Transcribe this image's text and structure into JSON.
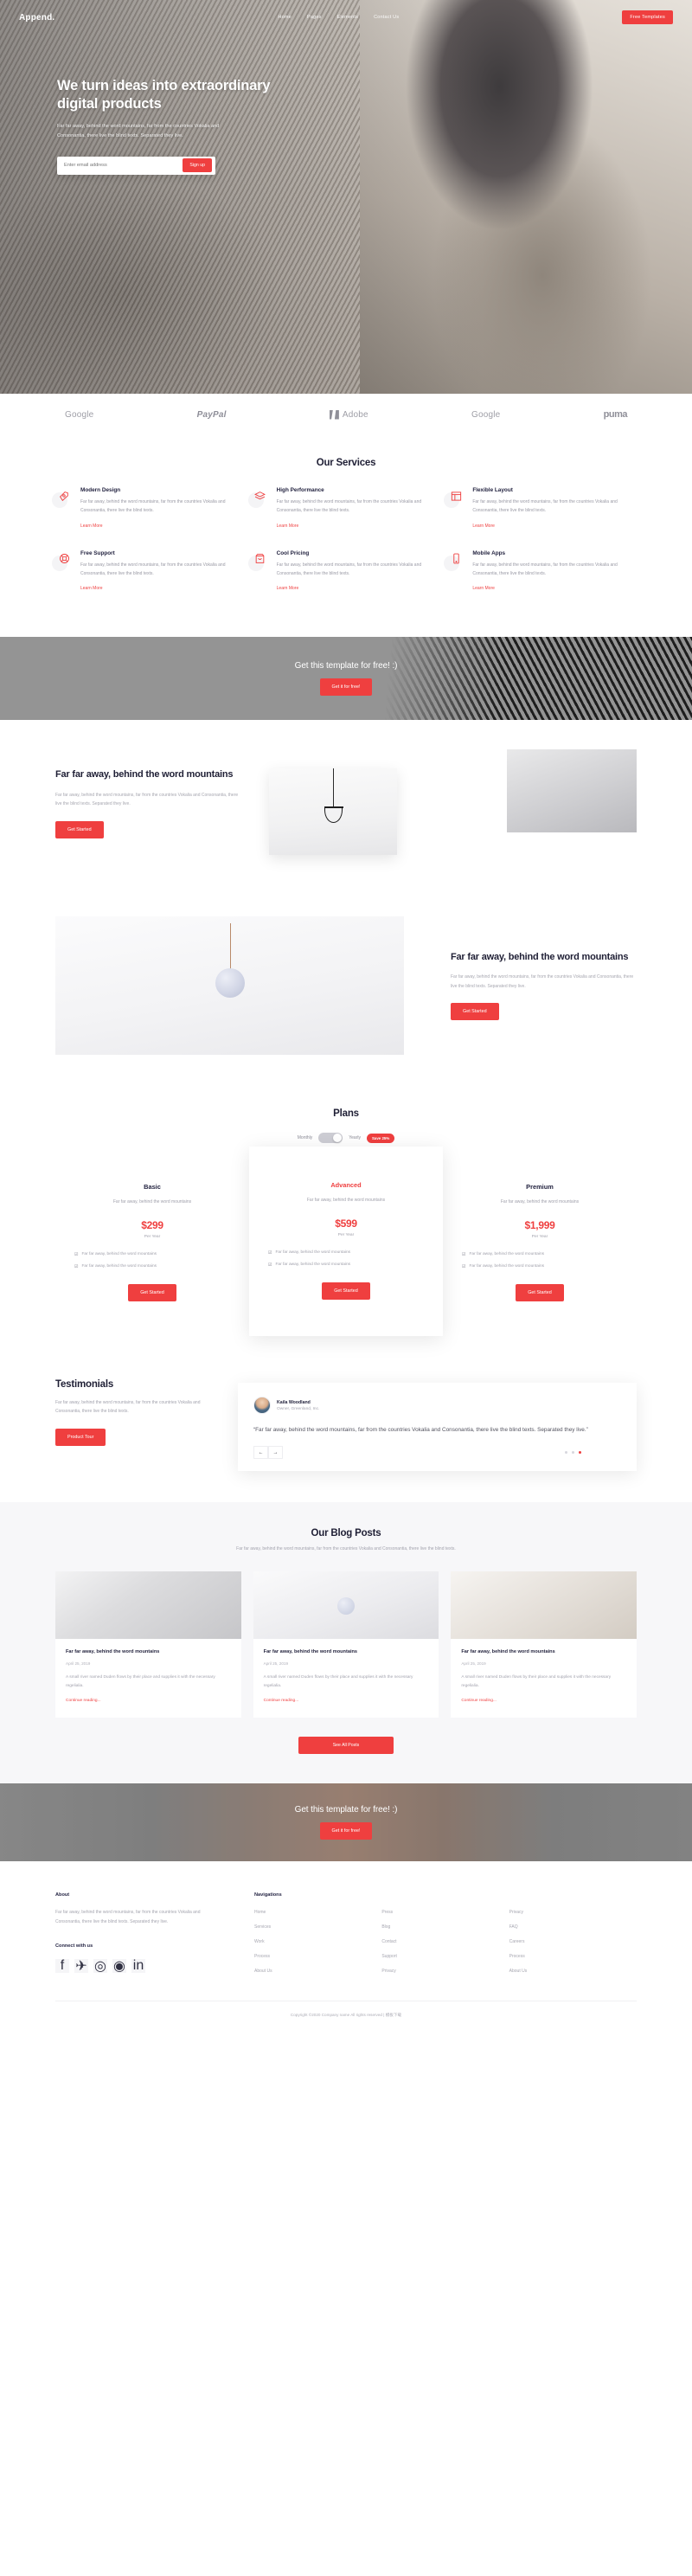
{
  "header": {
    "brand": "Append.",
    "nav": [
      {
        "label": "Home"
      },
      {
        "label": "Pages"
      },
      {
        "label": "Elements"
      },
      {
        "label": "Contact Us"
      }
    ],
    "cta_label": "Free Templates"
  },
  "hero": {
    "title": "We turn ideas into extraordinary digital products",
    "subtitle": "Far far away, behind the word mountains, far from the countries Vokalia and Consonantia, there live the blind texts. Separated they live.",
    "email_placeholder": "Enter email address",
    "email_value": "",
    "signup_label": "Sign up"
  },
  "brands": [
    {
      "name": "Google"
    },
    {
      "name": "PayPal"
    },
    {
      "name": "Adobe"
    },
    {
      "name": "Google"
    },
    {
      "name": "puma"
    }
  ],
  "services": {
    "title": "Our Services",
    "link_label": "Learn More",
    "items": [
      {
        "icon": "pen-nib-icon",
        "title": "Modern Design",
        "text": "Far far away, behind the word mountains, far from the countries Vokalia and Consonantia, there live the blind texts."
      },
      {
        "icon": "layers-icon",
        "title": "High Performance",
        "text": "Far far away, behind the word mountains, far from the countries Vokalia and Consonantia, there live the blind texts."
      },
      {
        "icon": "window-layout-icon",
        "title": "Flexible Layout",
        "text": "Far far away, behind the word mountains, far from the countries Vokalia and Consonantia, there live the blind texts."
      },
      {
        "icon": "lifebuoy-icon",
        "title": "Free Support",
        "text": "Far far away, behind the word mountains, far from the countries Vokalia and Consonantia, there live the blind texts."
      },
      {
        "icon": "shopping-bag-icon",
        "title": "Cool Pricing",
        "text": "Far far away, behind the word mountains, far from the countries Vokalia and Consonantia, there live the blind texts."
      },
      {
        "icon": "mobile-phone-icon",
        "title": "Mobile Apps",
        "text": "Far far away, behind the word mountains, far from the countries Vokalia and Consonantia, there live the blind texts."
      }
    ]
  },
  "cta_banner": {
    "heading": "Get this template for free! :)",
    "button_label": "Get it for free!"
  },
  "feature_one": {
    "heading": "Far far away, behind the word mountains",
    "text": "Far far away, behind the word mountains, far from the countries Vokalia and Consonantia, there live the blind texts. Separated they live.",
    "button_label": "Get Started"
  },
  "feature_two": {
    "heading": "Far far away, behind the word mountains",
    "text": "Far far away, behind the word mountains, far from the countries Vokalia and Consonantia, there live the blind texts. Separated they live.",
    "button_label": "Get Started"
  },
  "plans": {
    "title": "Plans",
    "toggle_left": "Monthly",
    "toggle_right": "Yearly",
    "save_badge": "Save 25%",
    "items": [
      {
        "name": "Basic",
        "desc": "Far far away, behind the word mountains",
        "price": "$299",
        "period": "Per Year",
        "features": [
          "Far far away, behind the word mountains",
          "Far far away, behind the word mountains"
        ],
        "button_label": "Get Started",
        "featured": false
      },
      {
        "name": "Advanced",
        "desc": "Far far away, behind the word mountains",
        "price": "$599",
        "period": "Per Year",
        "features": [
          "Far far away, behind the word mountains",
          "Far far away, behind the word mountains"
        ],
        "button_label": "Get Started",
        "featured": true
      },
      {
        "name": "Premium",
        "desc": "Far far away, behind the word mountains",
        "price": "$1,999",
        "period": "Per Year",
        "features": [
          "Far far away, behind the word mountains",
          "Far far away, behind the word mountains"
        ],
        "button_label": "Get Started",
        "featured": false
      }
    ]
  },
  "testimonials": {
    "title": "Testimonials",
    "text": "Far far away, behind the word mountains, far from the countries Vokalia and Consonantia, there live the blind texts.",
    "button_label": "Product Tour",
    "person_name": "Kaila Woodland",
    "person_role": "Owner, Greenland, Inc.",
    "quote": "“Far far away, behind the word mountains, far from the countries Vokalia and Consonantia, there live the blind texts. Separated they live.”",
    "prev_icon": "arrow-left-icon",
    "next_icon": "arrow-right-icon",
    "active_dot": 3
  },
  "blog": {
    "title": "Our Blog Posts",
    "subtitle": "Far far away, behind the word mountains, far from the countries Vokalia and Consonantia, there live the blind texts.",
    "see_all_label": "See All Posts",
    "posts": [
      {
        "title": "Far far away, behind the word mountains",
        "date": "April 25, 2019",
        "excerpt": "A small river named Duden flows by their place and supplies it with the necessary regelialia.",
        "link": "Continue reading..."
      },
      {
        "title": "Far far away, behind the word mountains",
        "date": "April 25, 2019",
        "excerpt": "A small river named Duden flows by their place and supplies it with the necessary regelialia.",
        "link": "Continue reading..."
      },
      {
        "title": "Far far away, behind the word mountains",
        "date": "April 25, 2019",
        "excerpt": "A small river named Duden flows by their place and supplies it with the necessary regelialia.",
        "link": "Continue reading..."
      }
    ]
  },
  "cta_banner_two": {
    "heading": "Get this template for free! :)",
    "button_label": "Get it for free!"
  },
  "footer": {
    "about_title": "About",
    "about_text": "Far far away, behind the word mountains, far from the countries Vokalia and Consonantia, there live the blind texts. Separated they live.",
    "connect_title": "Connect with us",
    "socials": [
      {
        "icon": "facebook-icon",
        "glyph": "f"
      },
      {
        "icon": "twitter-icon",
        "glyph": "✈"
      },
      {
        "icon": "instagram-icon",
        "glyph": "◎"
      },
      {
        "icon": "dribbble-icon",
        "glyph": "◉"
      },
      {
        "icon": "linkedin-icon",
        "glyph": "in"
      }
    ],
    "nav_title": "Navigations",
    "columns": [
      [
        "Home",
        "Services",
        "Work",
        "Process",
        "About Us"
      ],
      [
        "Press",
        "Blog",
        "Contact",
        "Support",
        "Privacy"
      ],
      [
        "Privacy",
        "FAQ",
        "Careers",
        "Process",
        "About Us"
      ]
    ],
    "copyright": "Copyright ©2020 Company name All rights reserved | 模板下载"
  },
  "colors": {
    "accent": "#ef3f3f",
    "heading": "#1f1f35",
    "body": "#a3a3ae"
  }
}
